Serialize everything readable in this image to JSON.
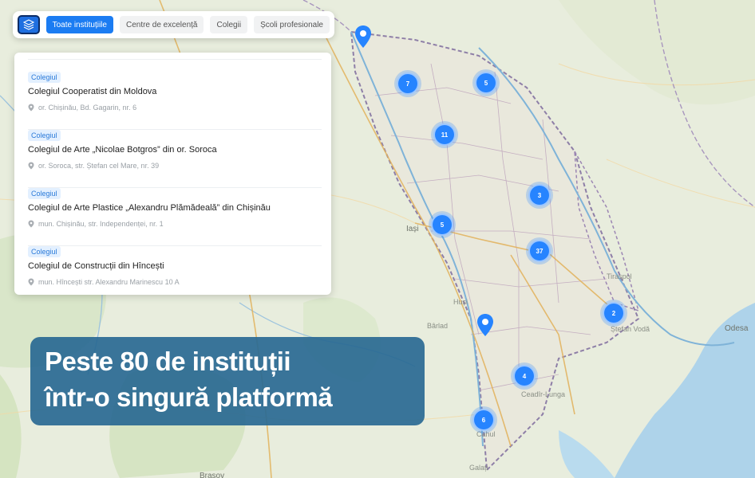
{
  "filters": {
    "layers_icon": "layers-icon",
    "chips": [
      {
        "label": "Toate instituțiile",
        "active": true
      },
      {
        "label": "Centre de excelență",
        "active": false
      },
      {
        "label": "Colegii",
        "active": false
      },
      {
        "label": "Școli profesionale",
        "active": false
      }
    ]
  },
  "list": {
    "items": [
      {
        "badge": "Colegiul",
        "title": "Colegiul Cooperatist din Moldova",
        "address": "or. Chișinău, Bd. Gagarin, nr. 6"
      },
      {
        "badge": "Colegiul",
        "title": "Colegiul de Arte „Nicolae Botgros” din or. Soroca",
        "address": "or. Soroca, str. Ștefan cel Mare, nr. 39"
      },
      {
        "badge": "Colegiul",
        "title": "Colegiul de Arte Plastice „Alexandru Plămădeală” din Chișinău",
        "address": "mun. Chișinău, str. Independenței, nr. 1"
      },
      {
        "badge": "Colegiul",
        "title": "Colegiul de Construcții din Hîncești",
        "address": "mun. Hîncești str. Alexandru Marinescu 10 A"
      }
    ]
  },
  "clusters": [
    "7",
    "5",
    "11",
    "3",
    "5",
    "37",
    "2",
    "4",
    "6"
  ],
  "map_labels": {
    "iasi": "Iași",
    "odesa": "Odesa",
    "brasov": "Brașov",
    "ceadir_lunga": "Ceadîr-Lunga",
    "stefan_voda": "Ștefan Vodă",
    "cahul": "Cahul",
    "husi": "Huși",
    "tiraspol": "Tiraspol",
    "barlad": "Bârlad",
    "galati": "Galați"
  },
  "banner": {
    "line1": "Peste 80 de instituții",
    "line2": "într-o singură platformă"
  },
  "colors": {
    "accent": "#1b7cf2",
    "cluster": "#2684ff",
    "banner": "#296992"
  }
}
